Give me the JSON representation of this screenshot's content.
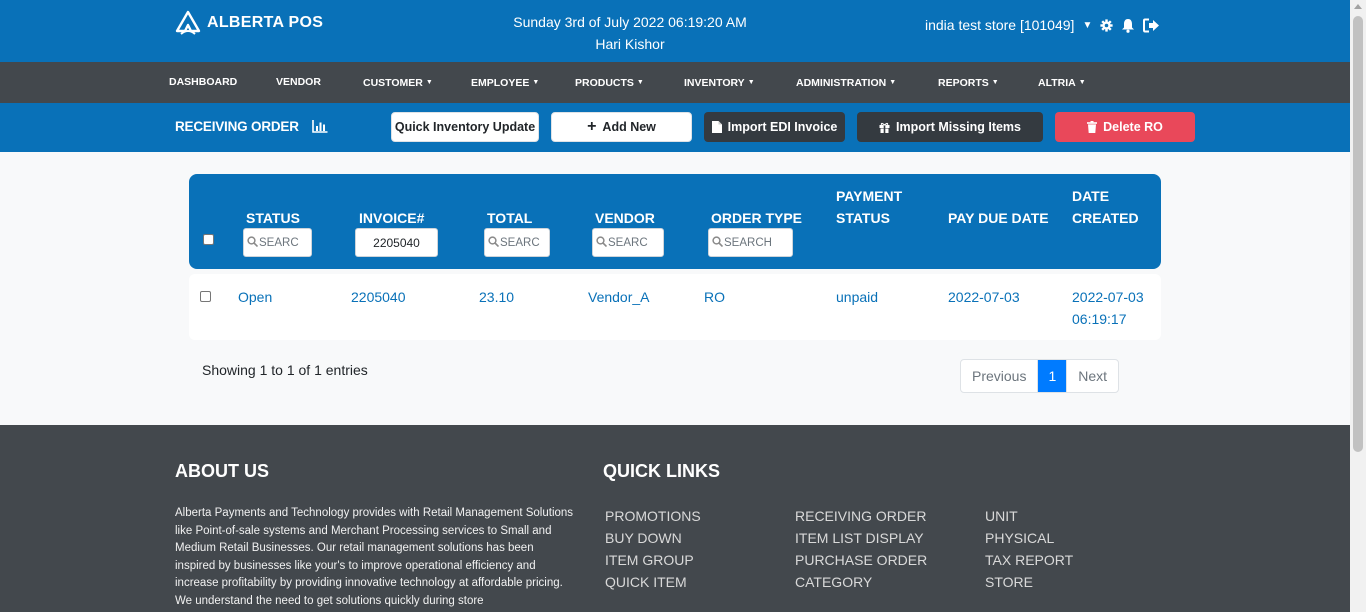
{
  "header": {
    "brand": "ALBERTA POS",
    "date_line": "Sunday 3rd of July 2022 06:19:20 AM",
    "user_name": "Hari Kishor",
    "store_name": "india test store [101049]",
    "icons": [
      "settings-icon",
      "bell-icon",
      "logout-icon"
    ]
  },
  "nav": {
    "items": [
      {
        "label": "DASHBOARD",
        "dropdown": false
      },
      {
        "label": "VENDOR",
        "dropdown": false
      },
      {
        "label": "CUSTOMER",
        "dropdown": true
      },
      {
        "label": "EMPLOYEE",
        "dropdown": true
      },
      {
        "label": "PRODUCTS",
        "dropdown": true
      },
      {
        "label": "INVENTORY",
        "dropdown": true
      },
      {
        "label": "ADMINISTRATION",
        "dropdown": true
      },
      {
        "label": "REPORTS",
        "dropdown": true
      },
      {
        "label": "ALTRIA",
        "dropdown": true
      }
    ]
  },
  "toolbar": {
    "title": "RECEIVING ORDER",
    "quick_inventory_label": "Quick Inventory Update",
    "add_new_label": "Add New",
    "import_edi_label": "Import EDI Invoice",
    "import_missing_label": "Import Missing Items",
    "delete_label": "Delete RO"
  },
  "table": {
    "columns": {
      "status": "STATUS",
      "invoice": "INVOICE#",
      "total": "TOTAL",
      "vendor": "VENDOR",
      "order_type": "ORDER TYPE",
      "payment_status_1": "PAYMENT",
      "payment_status_2": "STATUS",
      "pay_due_date": "PAY DUE DATE",
      "date_created_1": "DATE",
      "date_created_2": "CREATED"
    },
    "filters": {
      "status_placeholder": "SEARC",
      "invoice_value": "2205040",
      "total_placeholder": "SEARC",
      "vendor_placeholder": "SEARC",
      "order_type_placeholder": "SEARCH"
    },
    "rows": [
      {
        "status": "Open",
        "invoice": "2205040",
        "total": "23.10",
        "vendor": "Vendor_A",
        "order_type": "RO",
        "payment_status": "unpaid",
        "pay_due_date": "2022-07-03",
        "date_created_date": "2022-07-03",
        "date_created_time": "06:19:17"
      }
    ],
    "showing": "Showing 1 to 1 of 1 entries"
  },
  "pagination": {
    "previous": "Previous",
    "current": "1",
    "next": "Next"
  },
  "footer": {
    "about_title": "ABOUT US",
    "about_text": "Alberta Payments and Technology provides with Retail Management Solutions like Point-of-sale systems and Merchant Processing services to Small and Medium Retail Businesses. Our retail management solutions has been inspired by businesses like your's to improve operational efficiency and increase profitability by providing innovative technology at affordable pricing. We understand the need to get solutions quickly during store",
    "links_title": "QUICK LINKS",
    "links_col1": [
      "PROMOTIONS",
      "BUY DOWN",
      "ITEM GROUP",
      "QUICK ITEM"
    ],
    "links_col2": [
      "RECEIVING ORDER",
      "ITEM LIST DISPLAY",
      "PURCHASE ORDER",
      "CATEGORY"
    ],
    "links_col3": [
      "UNIT",
      "PHYSICAL",
      "TAX REPORT",
      "STORE"
    ]
  },
  "colors": {
    "primary_blue": "#0971b8",
    "nav_dark": "#43484d",
    "danger": "#e9485a",
    "pager_active": "#007bff"
  }
}
